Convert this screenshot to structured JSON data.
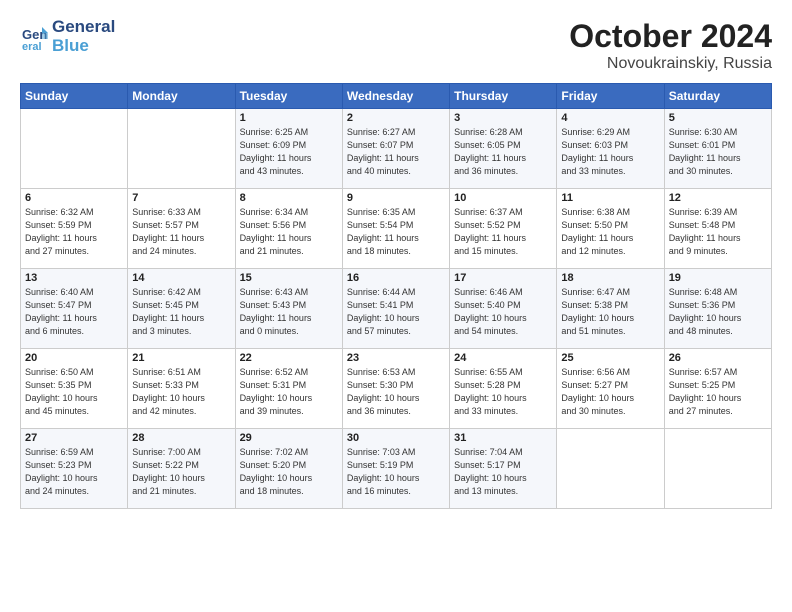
{
  "header": {
    "logo_line1": "General",
    "logo_line2": "Blue",
    "month_title": "October 2024",
    "location": "Novoukrainskiy, Russia"
  },
  "weekdays": [
    "Sunday",
    "Monday",
    "Tuesday",
    "Wednesday",
    "Thursday",
    "Friday",
    "Saturday"
  ],
  "weeks": [
    [
      {
        "day": "",
        "detail": ""
      },
      {
        "day": "",
        "detail": ""
      },
      {
        "day": "1",
        "detail": "Sunrise: 6:25 AM\nSunset: 6:09 PM\nDaylight: 11 hours\nand 43 minutes."
      },
      {
        "day": "2",
        "detail": "Sunrise: 6:27 AM\nSunset: 6:07 PM\nDaylight: 11 hours\nand 40 minutes."
      },
      {
        "day": "3",
        "detail": "Sunrise: 6:28 AM\nSunset: 6:05 PM\nDaylight: 11 hours\nand 36 minutes."
      },
      {
        "day": "4",
        "detail": "Sunrise: 6:29 AM\nSunset: 6:03 PM\nDaylight: 11 hours\nand 33 minutes."
      },
      {
        "day": "5",
        "detail": "Sunrise: 6:30 AM\nSunset: 6:01 PM\nDaylight: 11 hours\nand 30 minutes."
      }
    ],
    [
      {
        "day": "6",
        "detail": "Sunrise: 6:32 AM\nSunset: 5:59 PM\nDaylight: 11 hours\nand 27 minutes."
      },
      {
        "day": "7",
        "detail": "Sunrise: 6:33 AM\nSunset: 5:57 PM\nDaylight: 11 hours\nand 24 minutes."
      },
      {
        "day": "8",
        "detail": "Sunrise: 6:34 AM\nSunset: 5:56 PM\nDaylight: 11 hours\nand 21 minutes."
      },
      {
        "day": "9",
        "detail": "Sunrise: 6:35 AM\nSunset: 5:54 PM\nDaylight: 11 hours\nand 18 minutes."
      },
      {
        "day": "10",
        "detail": "Sunrise: 6:37 AM\nSunset: 5:52 PM\nDaylight: 11 hours\nand 15 minutes."
      },
      {
        "day": "11",
        "detail": "Sunrise: 6:38 AM\nSunset: 5:50 PM\nDaylight: 11 hours\nand 12 minutes."
      },
      {
        "day": "12",
        "detail": "Sunrise: 6:39 AM\nSunset: 5:48 PM\nDaylight: 11 hours\nand 9 minutes."
      }
    ],
    [
      {
        "day": "13",
        "detail": "Sunrise: 6:40 AM\nSunset: 5:47 PM\nDaylight: 11 hours\nand 6 minutes."
      },
      {
        "day": "14",
        "detail": "Sunrise: 6:42 AM\nSunset: 5:45 PM\nDaylight: 11 hours\nand 3 minutes."
      },
      {
        "day": "15",
        "detail": "Sunrise: 6:43 AM\nSunset: 5:43 PM\nDaylight: 11 hours\nand 0 minutes."
      },
      {
        "day": "16",
        "detail": "Sunrise: 6:44 AM\nSunset: 5:41 PM\nDaylight: 10 hours\nand 57 minutes."
      },
      {
        "day": "17",
        "detail": "Sunrise: 6:46 AM\nSunset: 5:40 PM\nDaylight: 10 hours\nand 54 minutes."
      },
      {
        "day": "18",
        "detail": "Sunrise: 6:47 AM\nSunset: 5:38 PM\nDaylight: 10 hours\nand 51 minutes."
      },
      {
        "day": "19",
        "detail": "Sunrise: 6:48 AM\nSunset: 5:36 PM\nDaylight: 10 hours\nand 48 minutes."
      }
    ],
    [
      {
        "day": "20",
        "detail": "Sunrise: 6:50 AM\nSunset: 5:35 PM\nDaylight: 10 hours\nand 45 minutes."
      },
      {
        "day": "21",
        "detail": "Sunrise: 6:51 AM\nSunset: 5:33 PM\nDaylight: 10 hours\nand 42 minutes."
      },
      {
        "day": "22",
        "detail": "Sunrise: 6:52 AM\nSunset: 5:31 PM\nDaylight: 10 hours\nand 39 minutes."
      },
      {
        "day": "23",
        "detail": "Sunrise: 6:53 AM\nSunset: 5:30 PM\nDaylight: 10 hours\nand 36 minutes."
      },
      {
        "day": "24",
        "detail": "Sunrise: 6:55 AM\nSunset: 5:28 PM\nDaylight: 10 hours\nand 33 minutes."
      },
      {
        "day": "25",
        "detail": "Sunrise: 6:56 AM\nSunset: 5:27 PM\nDaylight: 10 hours\nand 30 minutes."
      },
      {
        "day": "26",
        "detail": "Sunrise: 6:57 AM\nSunset: 5:25 PM\nDaylight: 10 hours\nand 27 minutes."
      }
    ],
    [
      {
        "day": "27",
        "detail": "Sunrise: 6:59 AM\nSunset: 5:23 PM\nDaylight: 10 hours\nand 24 minutes."
      },
      {
        "day": "28",
        "detail": "Sunrise: 7:00 AM\nSunset: 5:22 PM\nDaylight: 10 hours\nand 21 minutes."
      },
      {
        "day": "29",
        "detail": "Sunrise: 7:02 AM\nSunset: 5:20 PM\nDaylight: 10 hours\nand 18 minutes."
      },
      {
        "day": "30",
        "detail": "Sunrise: 7:03 AM\nSunset: 5:19 PM\nDaylight: 10 hours\nand 16 minutes."
      },
      {
        "day": "31",
        "detail": "Sunrise: 7:04 AM\nSunset: 5:17 PM\nDaylight: 10 hours\nand 13 minutes."
      },
      {
        "day": "",
        "detail": ""
      },
      {
        "day": "",
        "detail": ""
      }
    ]
  ]
}
